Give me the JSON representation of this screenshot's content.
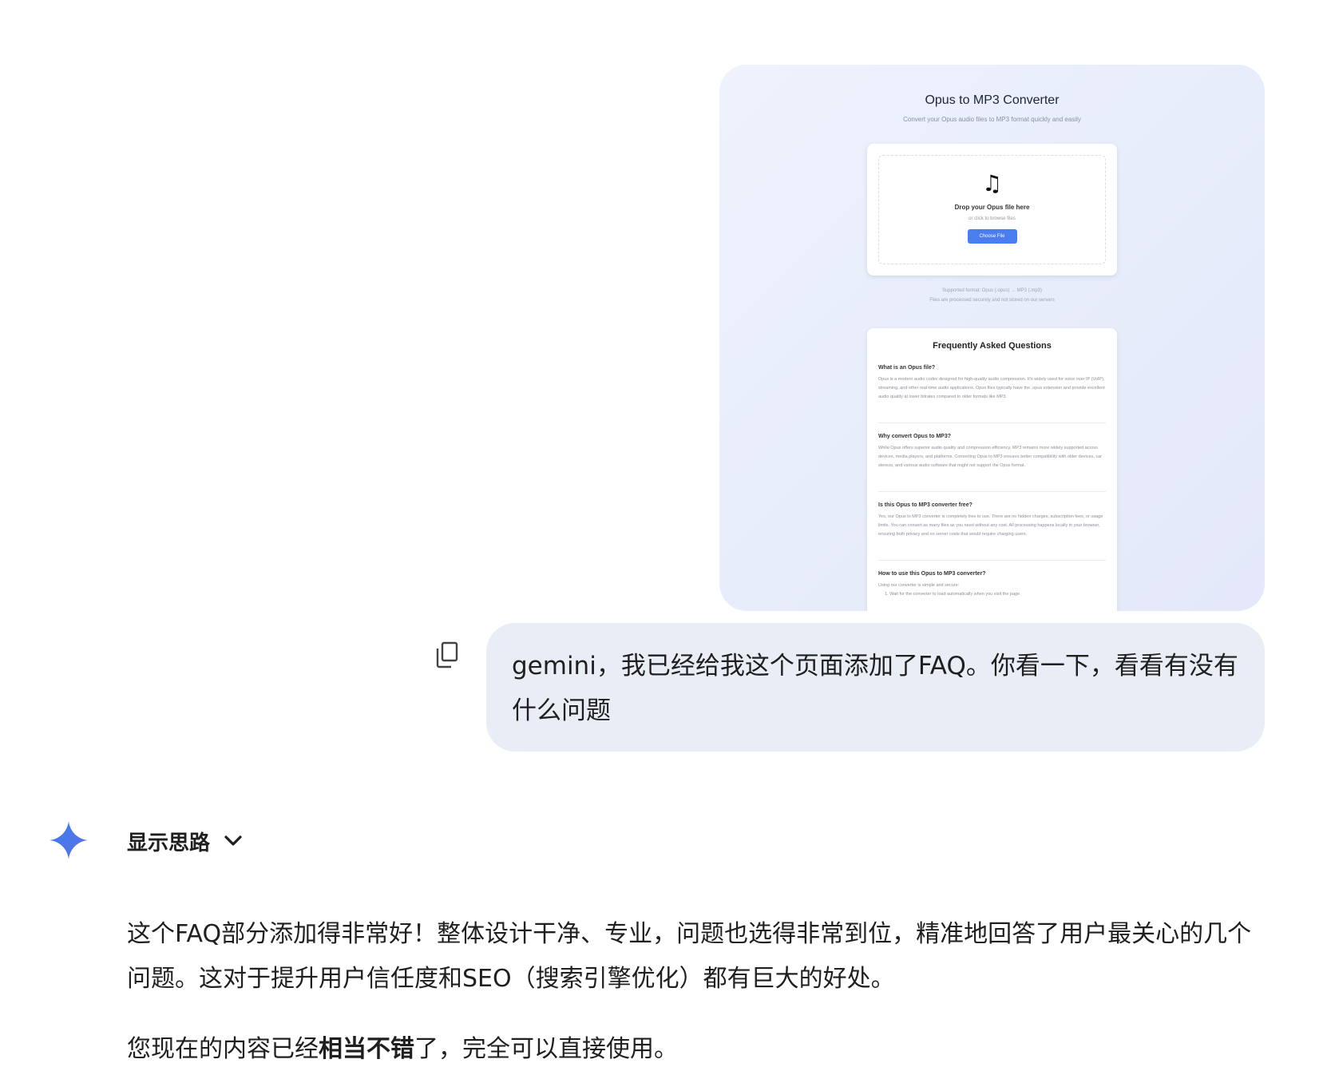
{
  "attachment": {
    "title": "Opus to MP3 Converter",
    "subtitle": "Convert your Opus audio files to MP3 format quickly and easily",
    "upload": {
      "drop_title": "Drop your Opus file here",
      "drop_sub": "or click to browse files",
      "button": "Choose File"
    },
    "support_line1": "Supported format: Opus (.opus) → MP3 (.mp3)",
    "support_line2": "Files are processed securely and not stored on our servers",
    "faq": {
      "title": "Frequently Asked Questions",
      "items": [
        {
          "q": "What is an Opus file?",
          "a": "Opus is a modern audio codec designed for high-quality audio compression. It's widely used for voice over IP (VoIP), streaming, and other real-time audio applications. Opus files typically have the .opus extension and provide excellent audio quality at lower bitrates compared to older formats like MP3."
        },
        {
          "q": "Why convert Opus to MP3?",
          "a": "While Opus offers superior audio quality and compression efficiency, MP3 remains more widely supported across devices, media players, and platforms. Converting Opus to MP3 ensures better compatibility with older devices, car stereos, and various audio software that might not support the Opus format."
        },
        {
          "q": "Is this Opus to MP3 converter free?",
          "a": "Yes, our Opus to MP3 converter is completely free to use. There are no hidden charges, subscription fees, or usage limits. You can convert as many files as you need without any cost. All processing happens locally in your browser, ensuring both privacy and no server costs that would require charging users."
        },
        {
          "q": "How to use this Opus to MP3 converter?",
          "a": "Using our converter is simple and secure:",
          "step": "1. Wait for the converter to load automatically when you visit the page"
        }
      ]
    }
  },
  "user_message": "gemini，我已经给我这个页面添加了FAQ。你看一下，看看有没有什么问题",
  "assistant": {
    "show_thinking": "显示思路",
    "paragraph1": "这个FAQ部分添加得非常好！整体设计干净、专业，问题也选得非常到位，精准地回答了用户最关心的几个问题。这对于提升用户信任度和SEO（搜索引擎优化）都有巨大的好处。",
    "paragraph2_pre": "您现在的内容已经",
    "paragraph2_bold": "相当不错",
    "paragraph2_post": "了，完全可以直接使用。"
  }
}
